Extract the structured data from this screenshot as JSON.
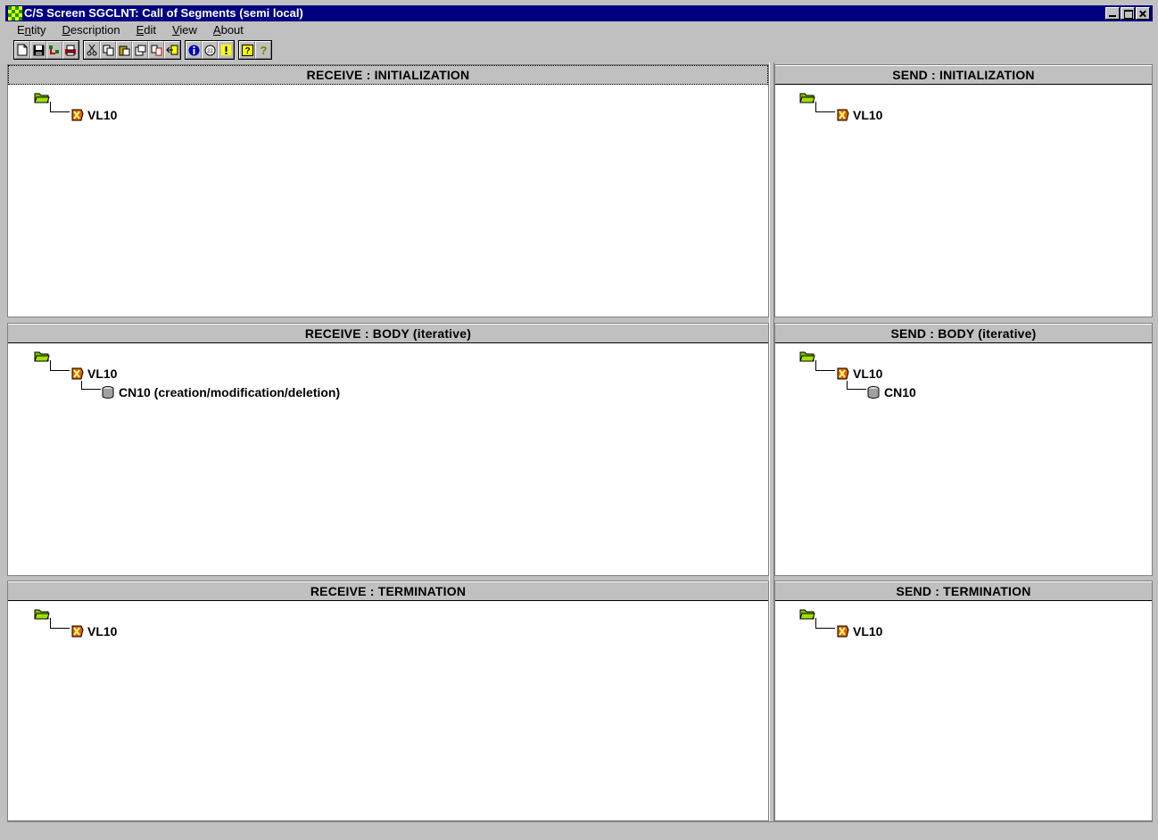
{
  "window": {
    "title": "C/S Screen SGCLNT: Call of Segments (semi local)"
  },
  "menu": [
    {
      "label": "Entity",
      "mnemonic_index": 1
    },
    {
      "label": "Description",
      "mnemonic_index": 0
    },
    {
      "label": "Edit",
      "mnemonic_index": 0
    },
    {
      "label": "View",
      "mnemonic_index": 0
    },
    {
      "label": "About",
      "mnemonic_index": 0
    }
  ],
  "toolbar": {
    "groups": [
      [
        "new-icon",
        "save-icon",
        "tree-icon",
        "print-icon"
      ],
      [
        "cut-icon",
        "copy-icon",
        "paste-icon",
        "duplicate-icon",
        "compare-icon",
        "exit-icon"
      ],
      [
        "info-icon",
        "comment-icon",
        "warning-icon"
      ],
      [
        "help-icon",
        "context-help-icon"
      ]
    ]
  },
  "panes": {
    "receive_init": {
      "title": "RECEIVE : INITIALIZATION",
      "segment": "VL10"
    },
    "send_init": {
      "title": "SEND : INITIALIZATION",
      "segment": "VL10"
    },
    "receive_body": {
      "title": "RECEIVE : BODY (iterative)",
      "segment": "VL10",
      "child": "CN10 (creation/modification/deletion)"
    },
    "send_body": {
      "title": "SEND : BODY (iterative)",
      "segment": "VL10",
      "child": "CN10"
    },
    "receive_term": {
      "title": "RECEIVE : TERMINATION",
      "segment": "VL10"
    },
    "send_term": {
      "title": "SEND : TERMINATION",
      "segment": "VL10"
    }
  },
  "colors": {
    "titlebar": "#000080",
    "folder": "#7cc000",
    "segment": "#e06000",
    "face": "#c0c0c0"
  }
}
